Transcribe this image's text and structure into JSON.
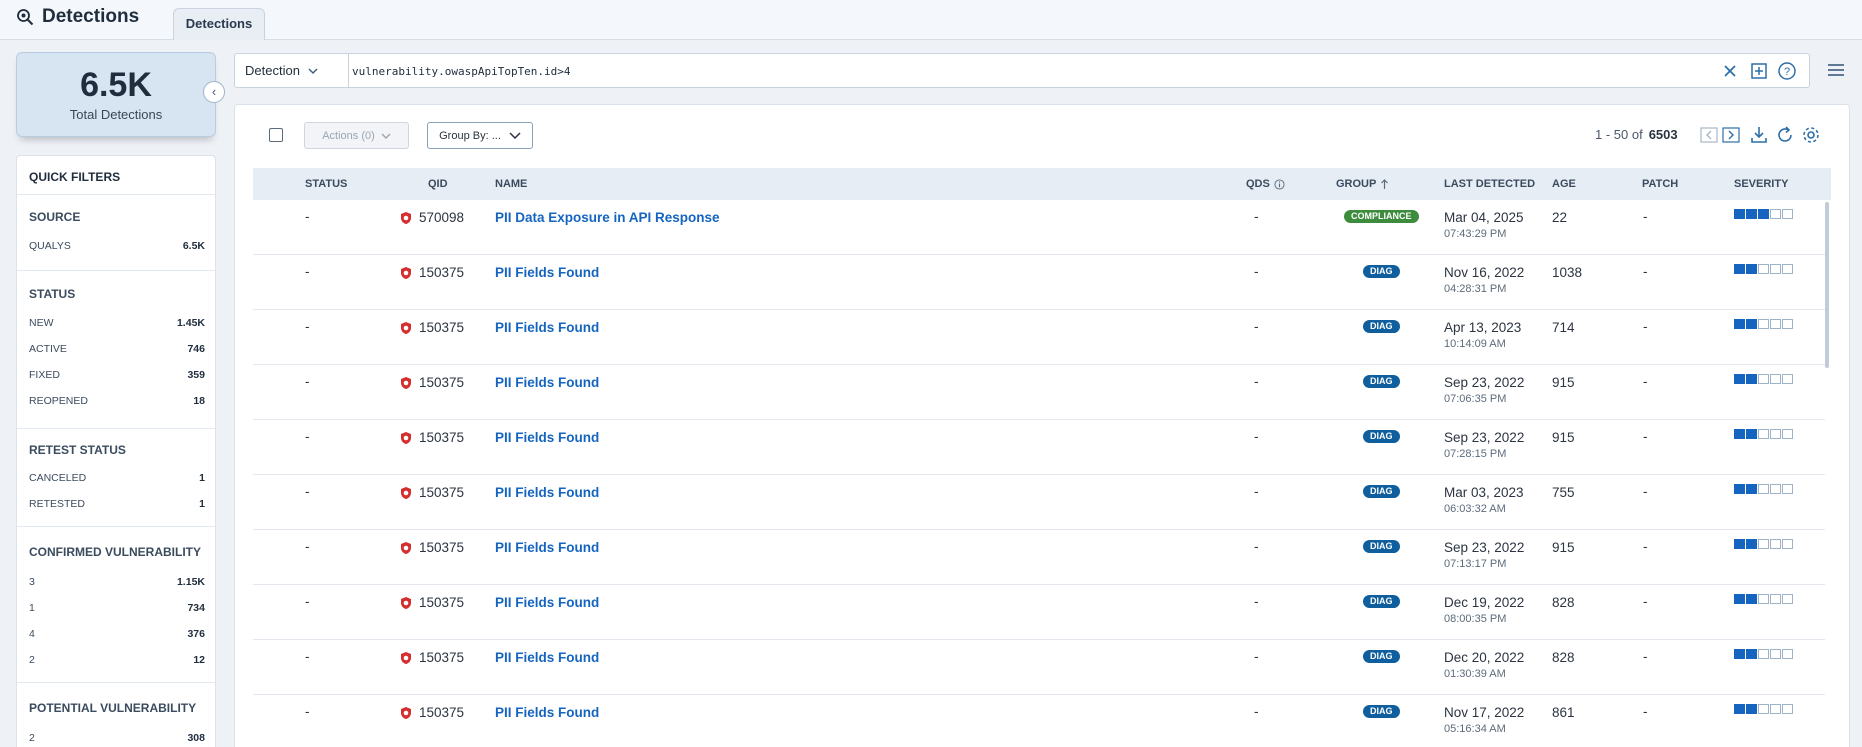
{
  "header": {
    "title": "Detections",
    "tab_label": "Detections"
  },
  "summary": {
    "total_value": "6.5K",
    "total_label": "Total Detections"
  },
  "quick_filters": {
    "title": "QUICK FILTERS",
    "groups": [
      {
        "heading": "SOURCE",
        "items": [
          {
            "label": "QUALYS",
            "count": "6.5K"
          }
        ]
      },
      {
        "heading": "STATUS",
        "items": [
          {
            "label": "NEW",
            "count": "1.45K"
          },
          {
            "label": "ACTIVE",
            "count": "746"
          },
          {
            "label": "FIXED",
            "count": "359"
          },
          {
            "label": "REOPENED",
            "count": "18"
          }
        ]
      },
      {
        "heading": "RETEST STATUS",
        "items": [
          {
            "label": "CANCELED",
            "count": "1"
          },
          {
            "label": "RETESTED",
            "count": "1"
          }
        ]
      },
      {
        "heading": "CONFIRMED VULNERABILITY",
        "items": [
          {
            "label": "3",
            "count": "1.15K"
          },
          {
            "label": "1",
            "count": "734"
          },
          {
            "label": "4",
            "count": "376"
          },
          {
            "label": "2",
            "count": "12"
          }
        ]
      },
      {
        "heading": "POTENTIAL VULNERABILITY",
        "items": [
          {
            "label": "2",
            "count": "308"
          }
        ]
      }
    ]
  },
  "search": {
    "type": "Detection",
    "query": "vulnerability.owaspApiTopTen.id>4"
  },
  "toolbar": {
    "actions_label": "Actions (0)",
    "groupby_label": "Group By: ..."
  },
  "pager": {
    "range": "1 - 50 of",
    "total": "6503"
  },
  "table": {
    "columns": {
      "status": "STATUS",
      "qid": "QID",
      "name": "NAME",
      "qds": "QDS",
      "group": "GROUP",
      "last_detected": "LAST DETECTED",
      "age": "AGE",
      "patch": "PATCH",
      "severity": "SEVERITY"
    },
    "rows": [
      {
        "status": "-",
        "qid": "570098",
        "name": "PII Data Exposure in API Response",
        "qds": "-",
        "group": "COMPLIANCE",
        "date": "Mar 04, 2025",
        "time": "07:43:29 PM",
        "age": "22",
        "patch": "-",
        "severity": 3
      },
      {
        "status": "-",
        "qid": "150375",
        "name": "PII Fields Found",
        "qds": "-",
        "group": "DIAG",
        "date": "Nov 16, 2022",
        "time": "04:28:31 PM",
        "age": "1038",
        "patch": "-",
        "severity": 2
      },
      {
        "status": "-",
        "qid": "150375",
        "name": "PII Fields Found",
        "qds": "-",
        "group": "DIAG",
        "date": "Apr 13, 2023",
        "time": "10:14:09 AM",
        "age": "714",
        "patch": "-",
        "severity": 2
      },
      {
        "status": "-",
        "qid": "150375",
        "name": "PII Fields Found",
        "qds": "-",
        "group": "DIAG",
        "date": "Sep 23, 2022",
        "time": "07:06:35 PM",
        "age": "915",
        "patch": "-",
        "severity": 2
      },
      {
        "status": "-",
        "qid": "150375",
        "name": "PII Fields Found",
        "qds": "-",
        "group": "DIAG",
        "date": "Sep 23, 2022",
        "time": "07:28:15 PM",
        "age": "915",
        "patch": "-",
        "severity": 2
      },
      {
        "status": "-",
        "qid": "150375",
        "name": "PII Fields Found",
        "qds": "-",
        "group": "DIAG",
        "date": "Mar 03, 2023",
        "time": "06:03:32 AM",
        "age": "755",
        "patch": "-",
        "severity": 2
      },
      {
        "status": "-",
        "qid": "150375",
        "name": "PII Fields Found",
        "qds": "-",
        "group": "DIAG",
        "date": "Sep 23, 2022",
        "time": "07:13:17 PM",
        "age": "915",
        "patch": "-",
        "severity": 2
      },
      {
        "status": "-",
        "qid": "150375",
        "name": "PII Fields Found",
        "qds": "-",
        "group": "DIAG",
        "date": "Dec 19, 2022",
        "time": "08:00:35 PM",
        "age": "828",
        "patch": "-",
        "severity": 2
      },
      {
        "status": "-",
        "qid": "150375",
        "name": "PII Fields Found",
        "qds": "-",
        "group": "DIAG",
        "date": "Dec 20, 2022",
        "time": "01:30:39 AM",
        "age": "828",
        "patch": "-",
        "severity": 2
      },
      {
        "status": "-",
        "qid": "150375",
        "name": "PII Fields Found",
        "qds": "-",
        "group": "DIAG",
        "date": "Nov 17, 2022",
        "time": "05:16:34 AM",
        "age": "861",
        "patch": "-",
        "severity": 2
      }
    ]
  },
  "colors": {
    "compliance_badge": "#3d8b3d",
    "diag_badge": "#0f5f9e",
    "link": "#1565c0",
    "severity_on": "#1565c0"
  },
  "icons": {
    "qid_icon": "shield-bug-icon",
    "clear": "close-icon",
    "add": "plus-square-icon",
    "help": "help-icon",
    "menu": "hamburger-menu-icon",
    "download": "download-icon",
    "refresh": "refresh-icon",
    "settings": "gear-icon",
    "info": "info-icon"
  }
}
